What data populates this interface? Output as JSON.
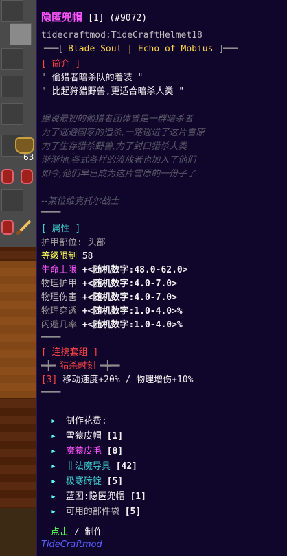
{
  "tooltip": {
    "item_name": "隐匿兜帽",
    "item_meta": "[1] (#9072)",
    "item_id": "tidecraftmod:TideCraftHelmet18",
    "set_banner_left": "━━━[",
    "set_banner_text": " Blade Soul | Echo of Mobius ",
    "set_banner_right": "]━━━",
    "intro_header": "[ 简介 ]",
    "quote1": "\" 偷猎者暗杀队的着装 \"",
    "quote2": "\" 比起狩猎野兽,更适合暗杀人类 \"",
    "lore_lines": [
      "据说最初的偷猎者团体曾是一群暗杀者",
      "为了逃避国家的追杀,一路逃进了这片雪原",
      "为了生存猎杀野兽,为了封口猎杀人类",
      "渐渐地,各式各样的流放者也加入了他们",
      "如今,他们早已成为这片雪原的一份子了"
    ],
    "lore_sign": "--某位维克托尔战士",
    "divider1": "━━━━",
    "attr_header": "[ 属性 ]",
    "armor_slot_label": "护甲部位:",
    "armor_slot_value": " 头部",
    "level_label": "等级限制",
    "level_value": " 58",
    "stats": [
      {
        "label": "生命上限",
        "value": " +<随机数字:48.0-62.0>",
        "color": "#ff55ff"
      },
      {
        "label": "物理护甲",
        "value": " +<随机数字:4.0-7.0>",
        "color": "#bdbdbd"
      },
      {
        "label": "物理伤害",
        "value": " +<随机数字:4.0-7.0>",
        "color": "#bdbdbd"
      },
      {
        "label": "物理穿透",
        "value": " +<随机数字:1.0-4.0>%",
        "color": "#9e9e9e"
      },
      {
        "label": "闪避几率",
        "value": " +<随机数字:1.0-4.0>%",
        "color": "#808080"
      }
    ],
    "divider2": "━━━━",
    "set_header": "[ 连携套组 ]",
    "set_name_left": "━╋━ ",
    "set_name": "猎杀时刻",
    "set_name_right": " ━╋━━",
    "set_bonus_count": "[3]",
    "set_bonus_text": " 移动速度+20% / 物理增伤+10%",
    "divider3": "━━━━",
    "craft_header": "制作花费:",
    "craft_items": [
      {
        "name": "雪猿皮帽",
        "count": " [1]",
        "color": "#e8e8e8"
      },
      {
        "name": "魔猿皮毛",
        "count": " [8]",
        "color": "#ff55ff"
      },
      {
        "name": "非法魔导具",
        "count": " [42]",
        "color": "#3fd0d0"
      },
      {
        "name": "极寒砖锭",
        "count": " [5]",
        "color": "#3fd0d0"
      },
      {
        "name": "蓝图:隐匿兜帽",
        "count": " [1]",
        "color": "#e8e8e8"
      },
      {
        "name": "可用的部件袋",
        "count": " [5]",
        "color": "#bdbdbd"
      }
    ],
    "action_click": "点击",
    "action_sep": " / ",
    "action_make": "制作",
    "mod_name": "TideCraftmod"
  },
  "inventory": {
    "stack_count": "63"
  },
  "colors": {
    "panel_bg": "#10052a",
    "title": "#ff55ff",
    "gold": "#ffd54a",
    "accent_red": "#ff4444",
    "accent_cyan": "#55ffff",
    "mod_blue": "#5560ff"
  }
}
